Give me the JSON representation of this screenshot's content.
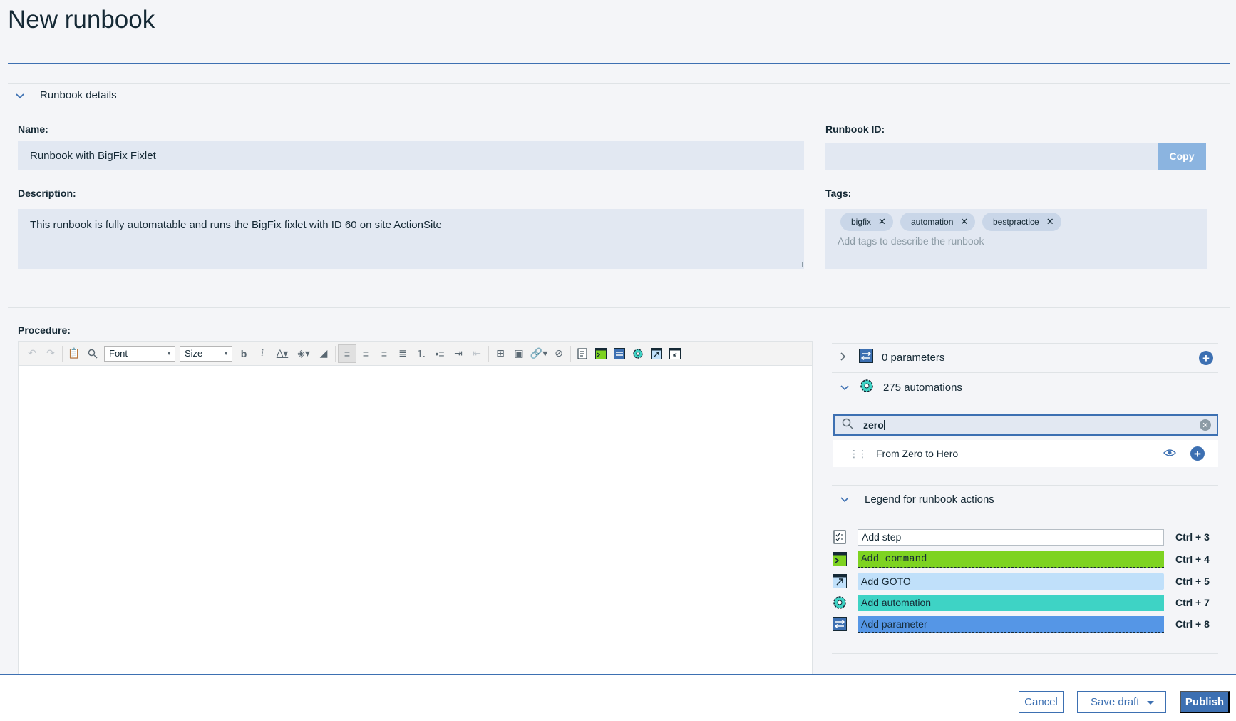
{
  "page": {
    "title": "New runbook"
  },
  "details": {
    "section_label": "Runbook details",
    "name_label": "Name:",
    "name_value": "Runbook with BigFix Fixlet",
    "description_label": "Description:",
    "description_value": "This runbook is fully automatable and runs the BigFix fixlet with ID 60 on site ActionSite",
    "runbook_id_label": "Runbook ID:",
    "runbook_id_value": "",
    "copy_label": "Copy",
    "tags_label": "Tags:",
    "tags": [
      "bigfix",
      "automation",
      "bestpractice"
    ],
    "tags_placeholder": "Add tags to describe the runbook"
  },
  "procedure": {
    "label": "Procedure:",
    "font_select": "Font",
    "size_select": "Size"
  },
  "panel": {
    "parameters_label": "0 parameters",
    "automations_label": "275 automations",
    "search_value": "zero",
    "result_label": "From Zero to Hero",
    "legend_title": "Legend for runbook actions",
    "legend": [
      {
        "label": "Add step",
        "shortcut": "Ctrl + 3",
        "color": "#ffffff",
        "icon": "step-icon"
      },
      {
        "label": "Add command",
        "shortcut": "Ctrl + 4",
        "color": "#7ed321",
        "icon": "command-icon"
      },
      {
        "label": "Add GOTO",
        "shortcut": "Ctrl + 5",
        "color": "#c0e0fa",
        "icon": "goto-icon"
      },
      {
        "label": "Add automation",
        "shortcut": "Ctrl + 7",
        "color": "#3ed3c5",
        "icon": "automation-icon"
      },
      {
        "label": "Add parameter",
        "shortcut": "Ctrl + 8",
        "color": "#5596e6",
        "icon": "parameter-icon"
      }
    ]
  },
  "footer": {
    "cancel_label": "Cancel",
    "save_draft_label": "Save draft",
    "publish_label": "Publish"
  }
}
